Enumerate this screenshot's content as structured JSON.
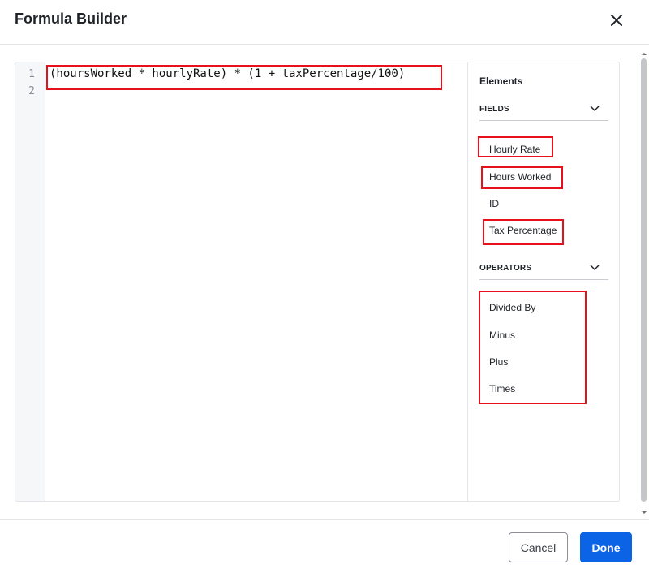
{
  "dialog": {
    "title": "Formula Builder"
  },
  "editor": {
    "line_numbers": [
      "1",
      "2"
    ],
    "lines": [
      "(hoursWorked * hourlyRate) * (1 + taxPercentage/100)",
      ""
    ]
  },
  "elements": {
    "title": "Elements",
    "fields": {
      "label": "FIELDS",
      "items": [
        "Hourly Rate",
        "Hours Worked",
        "ID",
        "Tax Percentage"
      ]
    },
    "operators": {
      "label": "OPERATORS",
      "items": [
        "Divided By",
        "Minus",
        "Plus",
        "Times"
      ]
    }
  },
  "footer": {
    "cancel_label": "Cancel",
    "done_label": "Done"
  },
  "colors": {
    "primary": "#0b63e5",
    "highlight": "#e8101a"
  },
  "icons": {
    "close": "close-icon",
    "collapse": "chevron-down-icon"
  }
}
